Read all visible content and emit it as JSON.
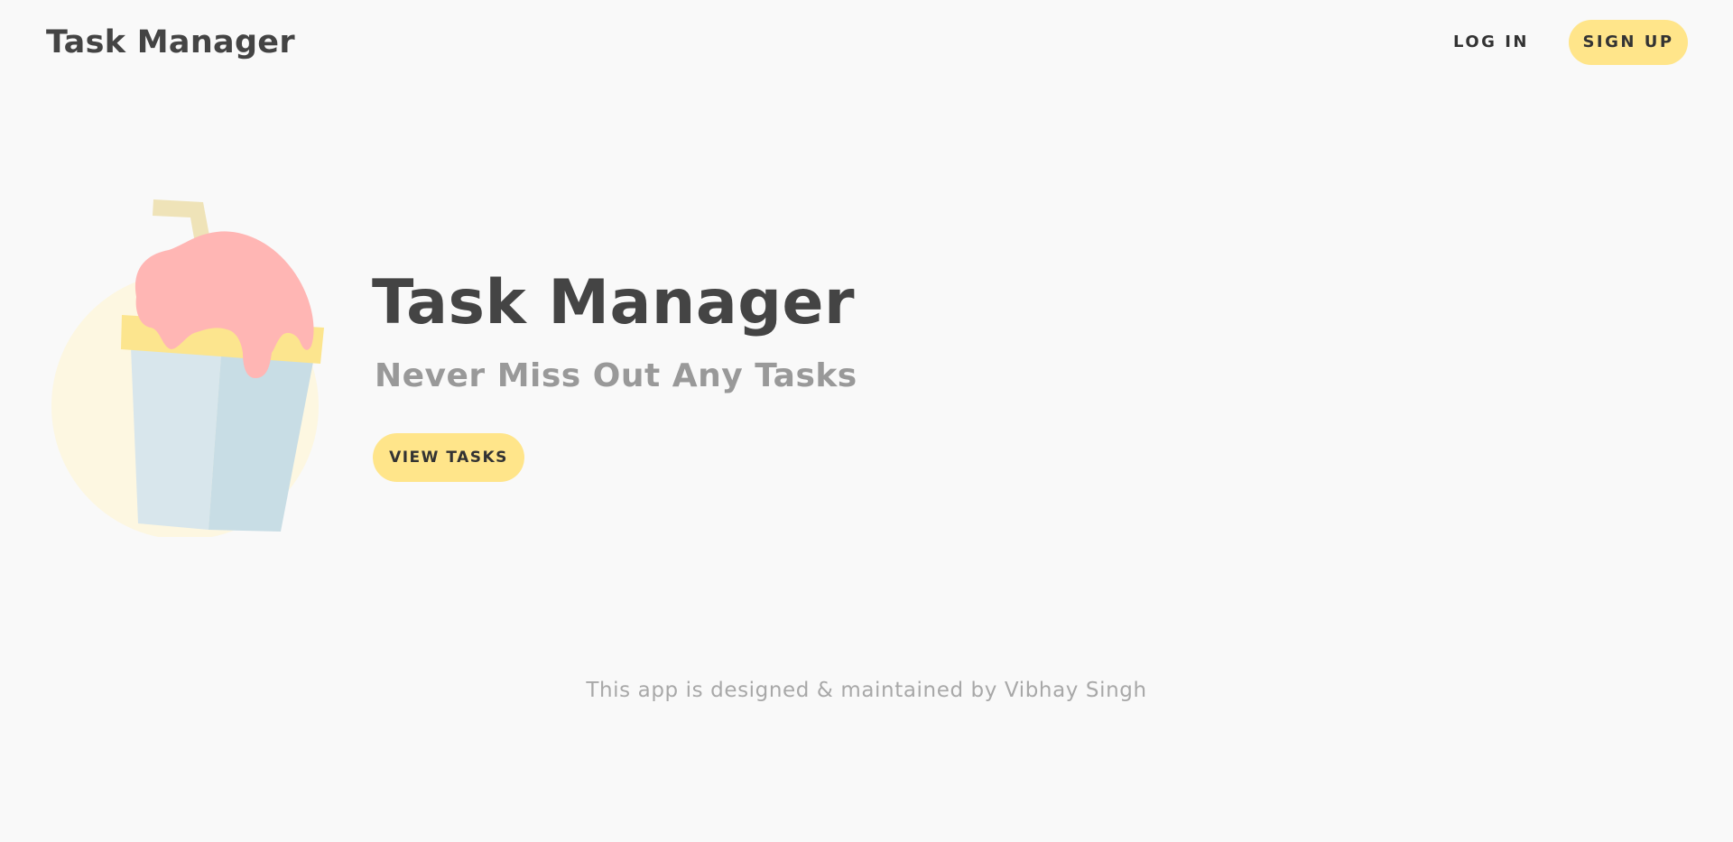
{
  "header": {
    "brand": "Task Manager",
    "login_label": "LOG IN",
    "signup_label": "SIGN UP"
  },
  "hero": {
    "title": "Task Manager",
    "subtitle": "Never Miss Out Any Tasks",
    "cta_label": "VIEW TASKS",
    "illustration": "ice-cream-cup-illustration"
  },
  "footer": {
    "credit": "This app is designed & maintained by Vibhay Singh"
  },
  "colors": {
    "background": "#f9f9f9",
    "accent_yellow": "#ffe58a",
    "text_dark": "#444444",
    "text_muted": "#999999"
  }
}
